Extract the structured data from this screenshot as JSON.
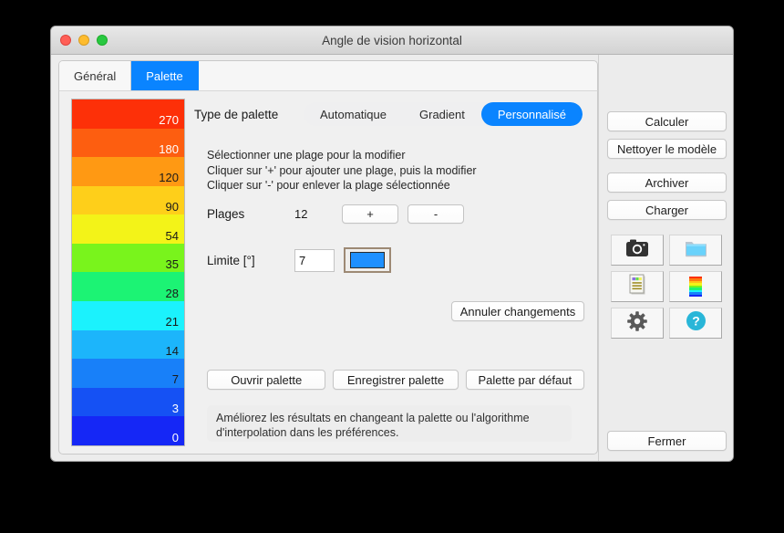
{
  "window": {
    "title": "Angle de vision horizontal",
    "traffic_lights": [
      "close",
      "minimize",
      "zoom"
    ]
  },
  "tabs": [
    {
      "label": "Général",
      "active": false
    },
    {
      "label": "Palette",
      "active": true
    }
  ],
  "palette": {
    "bands": [
      {
        "value": "270",
        "color": "#fd3008",
        "text_color": "#ffffff"
      },
      {
        "value": "180",
        "color": "#fd5e10",
        "text_color": "#ffffff"
      },
      {
        "value": "120",
        "color": "#ff9913",
        "text_color": "#1a1a1a"
      },
      {
        "value": "90",
        "color": "#fecf1a",
        "text_color": "#1a1a1a"
      },
      {
        "value": "54",
        "color": "#f3f318",
        "text_color": "#1a1a1a"
      },
      {
        "value": "35",
        "color": "#79f41c",
        "text_color": "#1a1a1a"
      },
      {
        "value": "28",
        "color": "#1cf374",
        "text_color": "#1a1a1a"
      },
      {
        "value": "21",
        "color": "#1bf2fd",
        "text_color": "#1a1a1a"
      },
      {
        "value": "14",
        "color": "#1cb5fb",
        "text_color": "#1a1a1a"
      },
      {
        "value": "7",
        "color": "#1880f9",
        "text_color": "#1a1a1a"
      },
      {
        "value": "3",
        "color": "#1551f4",
        "text_color": "#ffffff"
      },
      {
        "value": "0",
        "color": "#1527f6",
        "text_color": "#ffffff"
      }
    ]
  },
  "form": {
    "type_label": "Type de palette",
    "type_options": [
      {
        "label": "Automatique",
        "active": false
      },
      {
        "label": "Gradient",
        "active": false
      },
      {
        "label": "Personnalisé",
        "active": true
      }
    ],
    "hints": [
      "Sélectionner une plage pour la modifier",
      "Cliquer sur '+' pour ajouter une plage, puis la modifier",
      "Cliquer sur '-' pour enlever la plage sélectionnée"
    ],
    "plages_label": "Plages",
    "plages_count": "12",
    "add_label": "+",
    "remove_label": "-",
    "limite_label": "Limite [°]",
    "limite_value": "7",
    "limite_color": "#1e90ff",
    "annuler_label": "Annuler changements",
    "ouvrir_label": "Ouvrir palette",
    "enregistrer_label": "Enregistrer palette",
    "defaut_label": "Palette par défaut",
    "info_text": "Améliorez les résultats en changeant la palette ou l'algorithme d'interpolation dans les préférences."
  },
  "sidebar": {
    "calculer": "Calculer",
    "nettoyer": "Nettoyer le modèle",
    "archiver": "Archiver",
    "charger": "Charger",
    "fermer": "Fermer",
    "icons": [
      {
        "name": "camera-icon"
      },
      {
        "name": "folder-icon"
      },
      {
        "name": "report-icon"
      },
      {
        "name": "palette-icon"
      },
      {
        "name": "gear-icon"
      },
      {
        "name": "help-icon"
      }
    ]
  },
  "colors": {
    "accent": "#0a84ff",
    "window_bg": "#ececec",
    "panel_bg": "#f0f0f0",
    "help_cyan": "#29b6d8"
  }
}
